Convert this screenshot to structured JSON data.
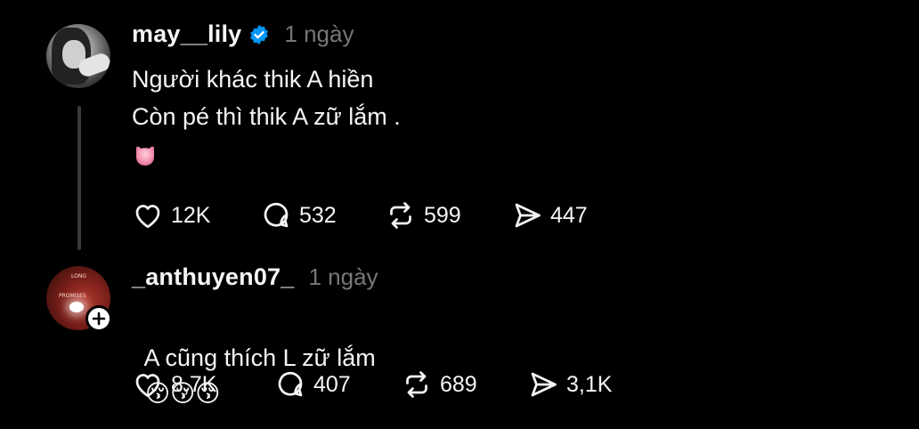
{
  "posts": [
    {
      "username": "may__lily",
      "verified": true,
      "time": "1 ngày",
      "lines": [
        "Người khác thik A hiền",
        "Còn pé thì thik A zữ lắm ."
      ],
      "emoji_icon": "heart-face-emoji",
      "actions": {
        "likes": "12K",
        "comments": "532",
        "reposts": "599",
        "shares": "447"
      }
    },
    {
      "username": "_anthuyen07_",
      "verified": false,
      "time": "1 ngày",
      "text": "A cũng thích L zữ lắm",
      "emojis": "😚😚😚",
      "actions": {
        "likes": "8,7K",
        "comments": "407",
        "reposts": "689",
        "shares": "3,1K"
      }
    }
  ],
  "colors": {
    "background": "#000000",
    "text": "#f3f5f7",
    "muted": "#777777",
    "verified": "#0095f6"
  }
}
